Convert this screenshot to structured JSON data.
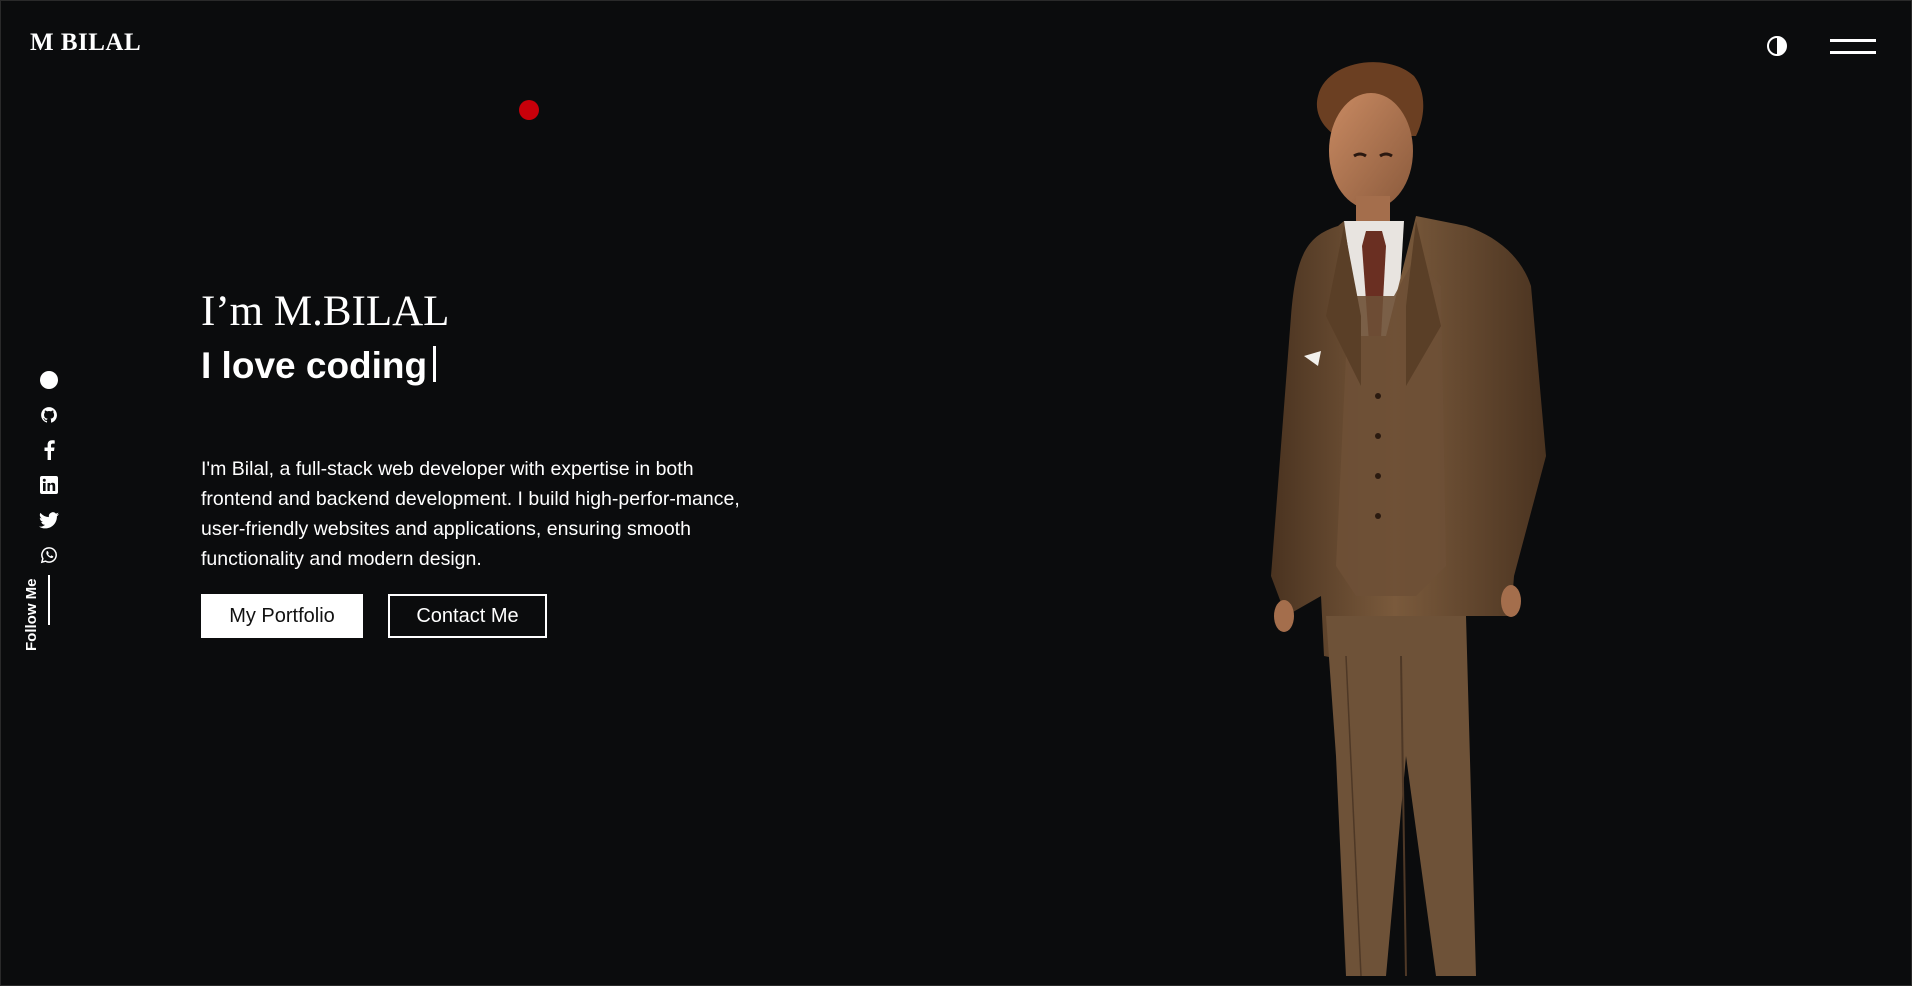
{
  "header": {
    "brand": "M BILAL",
    "theme_toggle_icon": "contrast-icon",
    "menu_icon": "hamburger-menu-icon"
  },
  "social": {
    "items": [
      {
        "name": "dot",
        "icon": "circle-icon"
      },
      {
        "name": "github",
        "icon": "github-icon"
      },
      {
        "name": "facebook",
        "icon": "facebook-icon"
      },
      {
        "name": "linkedin",
        "icon": "linkedin-icon"
      },
      {
        "name": "twitter",
        "icon": "twitter-icon"
      },
      {
        "name": "whatsapp",
        "icon": "whatsapp-icon"
      }
    ],
    "follow_label": "Follow Me"
  },
  "hero": {
    "greeting": "I’m M.BILAL",
    "tagline": "I love coding",
    "bio": "I'm Bilal, a full-stack web developer with expertise in both frontend and backend development. I build high-perfor-mance, user-friendly websites and applications, ensuring smooth functionality and modern design.",
    "primary_button": "My Portfolio",
    "secondary_button": "Contact Me"
  },
  "colors": {
    "background": "#0b0c0d",
    "text": "#ffffff",
    "cursor_dot": "#c8000a",
    "suit": "#6b4c30"
  }
}
